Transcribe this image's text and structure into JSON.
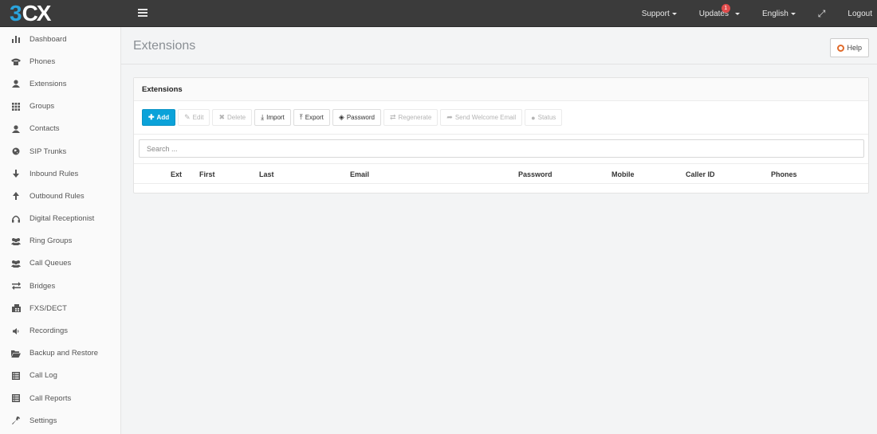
{
  "logo": {
    "part1": "3",
    "part2": "CX"
  },
  "topnav": {
    "support": "Support",
    "updates": "Updates",
    "updates_badge": "1",
    "language": "English",
    "logout": "Logout"
  },
  "sidebar": {
    "items": [
      {
        "label": "Dashboard",
        "icon": "bar-chart-icon"
      },
      {
        "label": "Phones",
        "icon": "phone-icon"
      },
      {
        "label": "Extensions",
        "icon": "user-icon"
      },
      {
        "label": "Groups",
        "icon": "grid-icon"
      },
      {
        "label": "Contacts",
        "icon": "user-icon"
      },
      {
        "label": "SIP Trunks",
        "icon": "globe-icon"
      },
      {
        "label": "Inbound Rules",
        "icon": "arrow-down-icon"
      },
      {
        "label": "Outbound Rules",
        "icon": "arrow-up-icon"
      },
      {
        "label": "Digital Receptionist",
        "icon": "headset-icon"
      },
      {
        "label": "Ring Groups",
        "icon": "users-icon"
      },
      {
        "label": "Call Queues",
        "icon": "users-icon"
      },
      {
        "label": "Bridges",
        "icon": "exchange-icon"
      },
      {
        "label": "FXS/DECT",
        "icon": "fax-icon"
      },
      {
        "label": "Recordings",
        "icon": "speaker-icon"
      },
      {
        "label": "Backup and Restore",
        "icon": "folder-open-icon"
      },
      {
        "label": "Call Log",
        "icon": "list-icon"
      },
      {
        "label": "Call Reports",
        "icon": "list-icon"
      },
      {
        "label": "Settings",
        "icon": "wrench-icon"
      }
    ]
  },
  "page": {
    "title": "Extensions",
    "help": "Help"
  },
  "panel": {
    "title": "Extensions",
    "toolbar": {
      "add": "Add",
      "edit": "Edit",
      "delete": "Delete",
      "import": "Import",
      "export": "Export",
      "password": "Password",
      "regenerate": "Regenerate",
      "send_welcome": "Send Welcome Email",
      "status": "Status"
    },
    "search_placeholder": "Search ...",
    "columns": [
      "Ext",
      "First",
      "Last",
      "Email",
      "Password",
      "Mobile",
      "Caller ID",
      "Phones"
    ]
  },
  "colors": {
    "accent": "#0ba2d9",
    "topbar": "#3b3b3b",
    "badge": "#e04b4b"
  }
}
